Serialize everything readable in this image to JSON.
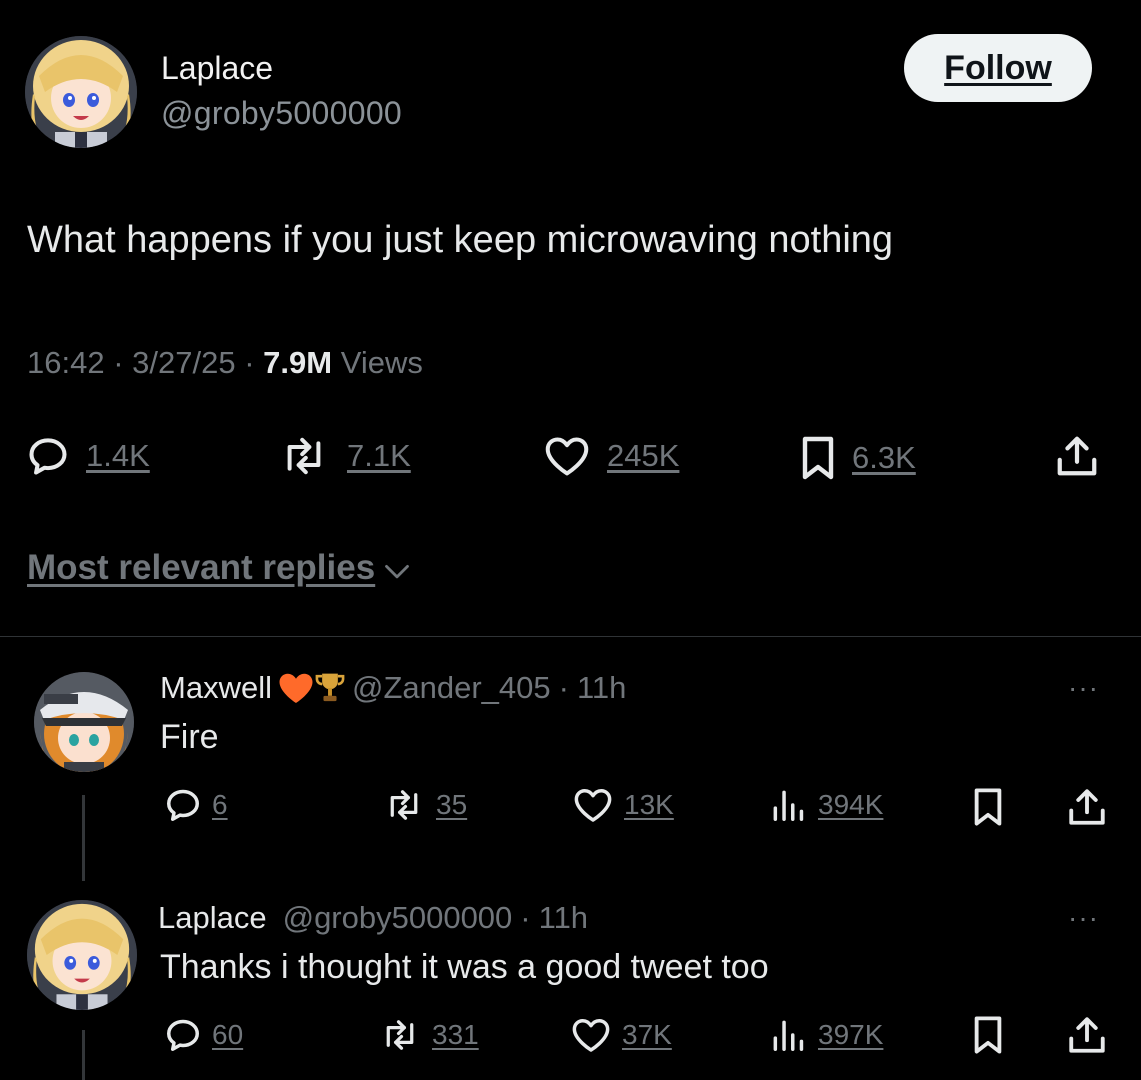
{
  "tweet": {
    "author_name": "Laplace",
    "author_handle": "@groby5000000",
    "follow_label": "Follow",
    "text": "What happens if you just keep microwaving nothing",
    "time": "16:42",
    "date": "3/27/25",
    "views_count": "7.9M",
    "views_label": "Views",
    "sep": "·",
    "stats": {
      "replies": "1.4K",
      "reposts": "7.1K",
      "likes": "245K",
      "bookmarks": "6.3K"
    }
  },
  "sort": {
    "label": "Most relevant replies"
  },
  "replies": [
    {
      "name": "Maxwell",
      "badges": "🧡🏆",
      "handle": "@Zander_405",
      "time": "11h",
      "text": "Fire",
      "stats": {
        "replies": "6",
        "reposts": "35",
        "likes": "13K",
        "views": "394K"
      },
      "more": "···"
    },
    {
      "name": "Laplace",
      "handle": "@groby5000000",
      "time": "11h",
      "text": "Thanks i thought it was a good tweet too",
      "stats": {
        "replies": "60",
        "reposts": "331",
        "likes": "37K",
        "views": "397K"
      },
      "more": "···"
    }
  ],
  "colors": {
    "background": "#000000",
    "text": "#e7e9ea",
    "muted": "#71767b",
    "follow_bg": "#eff3f4",
    "heart_badge": "#ff6a2a",
    "trophy_badge": "#c9922a"
  }
}
